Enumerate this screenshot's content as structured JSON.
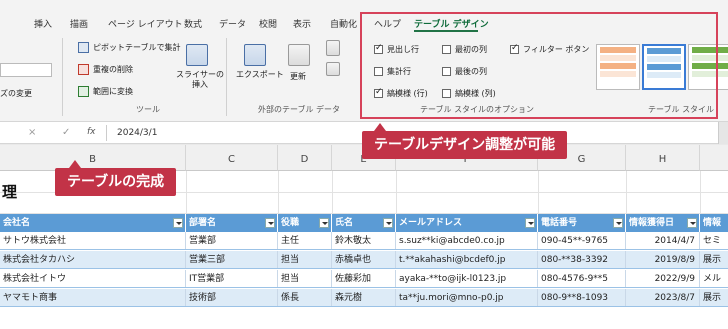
{
  "ribbon": {
    "tabs": [
      "挿入",
      "描画",
      "ページ レイアウト",
      "数式",
      "データ",
      "校閲",
      "表示",
      "自動化",
      "ヘルプ",
      "テーブル デザイン"
    ],
    "active_tab": "テーブル デザイン",
    "tools": {
      "summarize_pivot": "ピボットテーブルで集計",
      "remove_duplicates": "重複の削除",
      "convert_range": "範囲に変換",
      "slicer": "スライサーの\n挿入",
      "resize_partial": "ズの変更",
      "group_label": "ツール"
    },
    "external": {
      "export": "エクスポート",
      "refresh": "更新",
      "group_label": "外部のテーブル データ"
    },
    "style_options": {
      "header_row": "見出し行",
      "total_row": "集計行",
      "banded_rows": "縞模様 (行)",
      "first_column": "最初の列",
      "last_column": "最後の列",
      "banded_columns": "縞模様 (列)",
      "filter_button": "フィルター ボタン",
      "group_label": "テーブル スタイルのオプション"
    },
    "styles_label": "テーブル スタイル"
  },
  "formula_bar": {
    "cancel": "×",
    "enter": "✓",
    "fx": "fx",
    "value": "2024/3/1"
  },
  "columns": [
    "B",
    "C",
    "D",
    "E",
    "F",
    "G",
    "H"
  ],
  "sheet_title": "理",
  "callouts": {
    "table_done": "テーブルの完成",
    "design_possible": "テーブルデザイン調整が可能"
  },
  "table": {
    "headers": [
      "会社名",
      "部署名",
      "役職",
      "氏名",
      "メールアドレス",
      "電話番号",
      "情報獲得日",
      "情報"
    ],
    "rows": [
      [
        "サトウ株式会社",
        "営業部",
        "主任",
        "鈴木敬太",
        "s.suz**ki@abcde0.co.jp",
        "090-45**-9765",
        "2014/4/7",
        "セミ"
      ],
      [
        "株式会社タカハシ",
        "営業三部",
        "担当",
        "赤橋卓也",
        "t.**akahashi@bcdef0.jp",
        "080-**38-3392",
        "2019/8/9",
        "展示"
      ],
      [
        "株式会社イトウ",
        "IT営業部",
        "担当",
        "佐藤彩加",
        "ayaka-**to@ijk-l0123.jp",
        "080-4576-9**5",
        "2022/9/9",
        "メル"
      ],
      [
        "ヤマモト商事",
        "技術部",
        "係長",
        "森元樹",
        "ta**ju.mori@mno-p0.jp",
        "080-9**8-1093",
        "2023/8/7",
        "展示"
      ]
    ]
  },
  "colors": {
    "header_blue": "#5b9bd5",
    "band_blue": "#ddebf7",
    "callout_red": "#c23347",
    "highlight_pink": "#d6425a",
    "active_tab_green": "#217346"
  }
}
